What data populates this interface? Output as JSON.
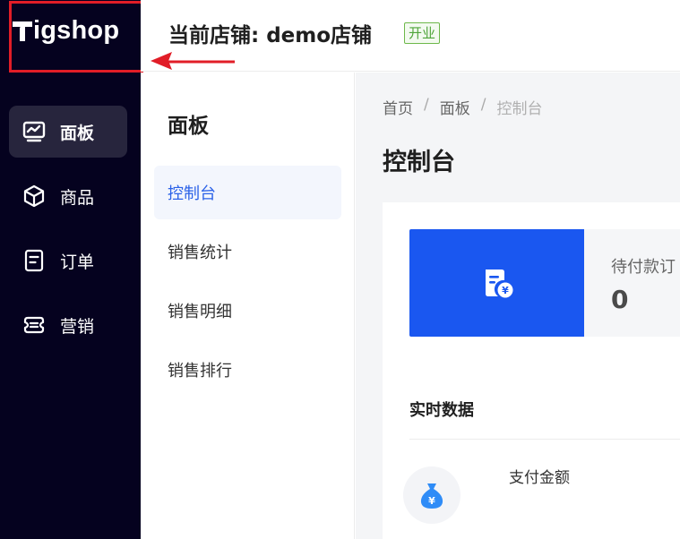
{
  "logo": {
    "text": "igshop"
  },
  "sidebar": {
    "items": [
      {
        "label": "面板",
        "icon": "dashboard-icon",
        "active": true
      },
      {
        "label": "商品",
        "icon": "cube-icon",
        "active": false
      },
      {
        "label": "订单",
        "icon": "document-icon",
        "active": false
      },
      {
        "label": "营销",
        "icon": "ticket-icon",
        "active": false
      }
    ]
  },
  "header": {
    "store_title": "当前店铺: demo店铺",
    "status_badge": "开业"
  },
  "subnav": {
    "title": "面板",
    "items": [
      {
        "label": "控制台",
        "active": true
      },
      {
        "label": "销售统计",
        "active": false
      },
      {
        "label": "销售明细",
        "active": false
      },
      {
        "label": "销售排行",
        "active": false
      }
    ]
  },
  "breadcrumb": [
    "首页",
    "面板",
    "控制台"
  ],
  "page_title": "控制台",
  "stat": {
    "label": "待付款订",
    "value": "0",
    "icon": "order-payment-icon"
  },
  "realtime": {
    "title": "实时数据",
    "pay_label": "支付金额",
    "icon": "money-bag-icon"
  },
  "colors": {
    "sidebar_bg": "#05021f",
    "accent": "#1a57f0",
    "highlight": "#e11d27",
    "badge": "#4fa53a"
  }
}
